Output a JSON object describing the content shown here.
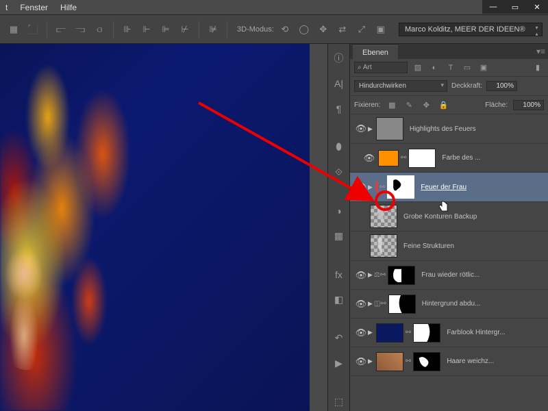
{
  "menu": {
    "fenster": "Fenster",
    "hilfe": "Hilfe"
  },
  "window": {
    "min": "—",
    "max": "▭",
    "close": "✕"
  },
  "toolbar": {
    "mode_label": "3D-Modus:",
    "workspace": "Marco Kolditz, MEER DER IDEEN®"
  },
  "panel": {
    "title": "Ebenen",
    "search_prefix": "⌕",
    "search_value": "Art",
    "blend_mode": "Hindurchwirken",
    "opacity_label": "Deckkraft:",
    "opacity_val": "100%",
    "lock_label": "Fixieren:",
    "fill_label": "Fläche:",
    "fill_val": "100%"
  },
  "layers": [
    {
      "name": "Highlights des Feuers",
      "visible": true,
      "arrow": true
    },
    {
      "name": "Farbe des ...",
      "visible": true,
      "indent": true,
      "swatch": true
    },
    {
      "name": "Feuer der Frau",
      "visible": true,
      "arrow": true,
      "selected": true
    },
    {
      "name": "Grobe Konturen Backup",
      "visible": false
    },
    {
      "name": "Feine Strukturen",
      "visible": false
    },
    {
      "name": "Frau wieder rötlic...",
      "visible": true,
      "arrow": true
    },
    {
      "name": "Hintergrund abdu...",
      "visible": true,
      "arrow": true
    },
    {
      "name": "Farblook Hintergr...",
      "visible": true,
      "arrow": true
    },
    {
      "name": "Haare weichz...",
      "visible": true,
      "arrow": true
    }
  ]
}
